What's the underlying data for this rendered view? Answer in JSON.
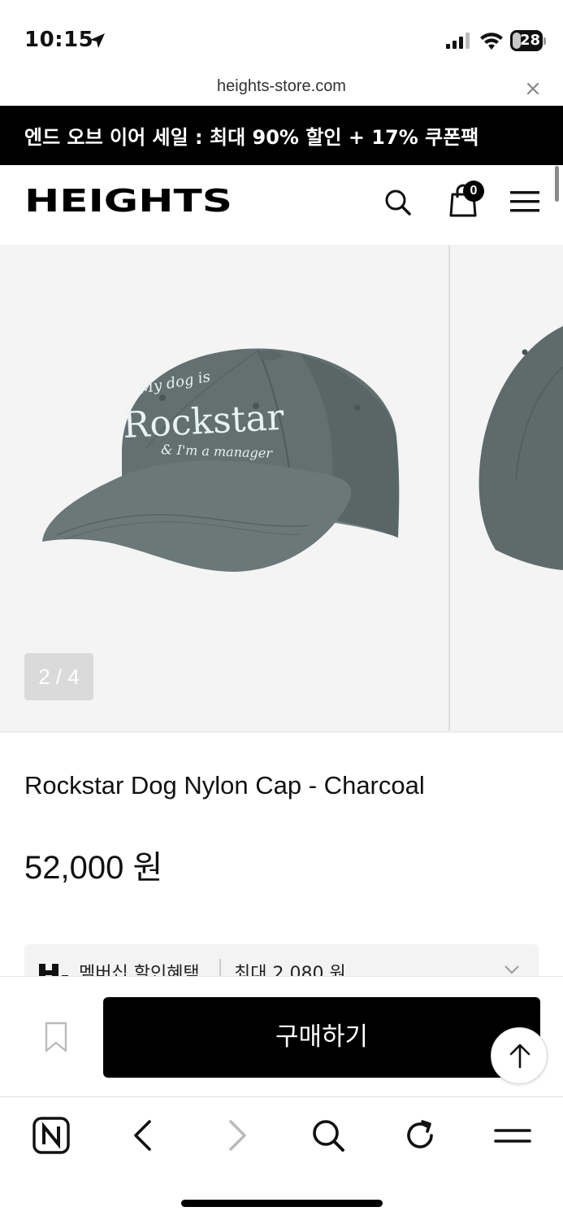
{
  "status_bar": {
    "time": "10:15",
    "battery_level": "28",
    "icons": [
      "location-arrow-icon",
      "cellular-signal-icon",
      "wifi-icon",
      "battery-icon"
    ]
  },
  "browser": {
    "url": "heights-store.com",
    "close_icon": "close-icon"
  },
  "promo_banner": {
    "text": "엔드 오브 이어 세일 : 최대 90% 할인 + 17% 쿠폰팩"
  },
  "header": {
    "logo_text": "HEIGHTS",
    "cart_count": "0",
    "icons": [
      "search-icon",
      "shopping-bag-icon",
      "hamburger-menu-icon"
    ]
  },
  "gallery": {
    "image_counter": "2 / 4",
    "cap_embroidery": {
      "line1": "My dog is",
      "line2": "Rockstar",
      "line3": "& I'm a manager"
    },
    "cap_color": "#5f6b6b"
  },
  "product": {
    "name": "Rockstar Dog Nylon Cap - Charcoal",
    "price": "52,000 원"
  },
  "membership": {
    "label": "멤버십 할인혜택",
    "value": "최대 2,080 원"
  },
  "buy_bar": {
    "buy_label": "구매하기",
    "icons": [
      "bookmark-icon",
      "arrow-up-icon"
    ]
  },
  "toolbar": {
    "icons": [
      "naver-home-icon",
      "back-arrow-icon",
      "forward-arrow-icon",
      "search-icon",
      "reload-icon",
      "menu-icon"
    ]
  },
  "colors": {
    "promo_background": "#000000",
    "buy_button": "#000000",
    "gallery_background": "#f4f4f4"
  }
}
